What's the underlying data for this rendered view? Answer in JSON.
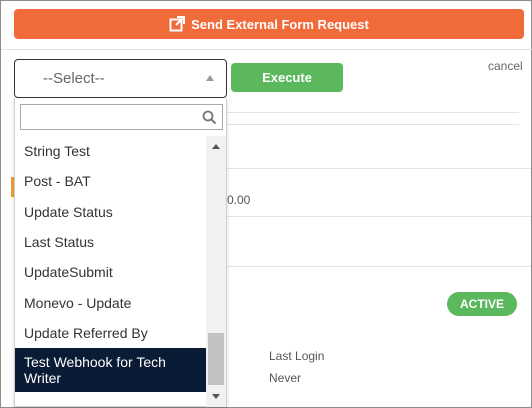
{
  "header": {
    "send_button_label": "Send External Form Request",
    "send_icon": "external-link-icon"
  },
  "toolbar": {
    "select_value": "--Select--",
    "execute_label": "Execute",
    "cancel_label": "cancel"
  },
  "background": {
    "amount_fragment": "0.00",
    "status_badge": "ACTIVE",
    "last_login_label": "Last Login",
    "last_login_value": "Never"
  },
  "dropdown": {
    "search_placeholder": "",
    "items": [
      {
        "label": "String Test"
      },
      {
        "label": "Post - BAT"
      },
      {
        "label": "Update Status"
      },
      {
        "label": "Last Status"
      },
      {
        "label": "UpdateSubmit"
      },
      {
        "label": "Monevo - Update"
      },
      {
        "label": "Update Referred By"
      },
      {
        "label": "Test Webhook for Tech Writer"
      }
    ],
    "highlighted_index": 7
  },
  "colors": {
    "orange": "#f06a3a",
    "green": "#5cb85c",
    "highlight": "#0a1b35"
  }
}
